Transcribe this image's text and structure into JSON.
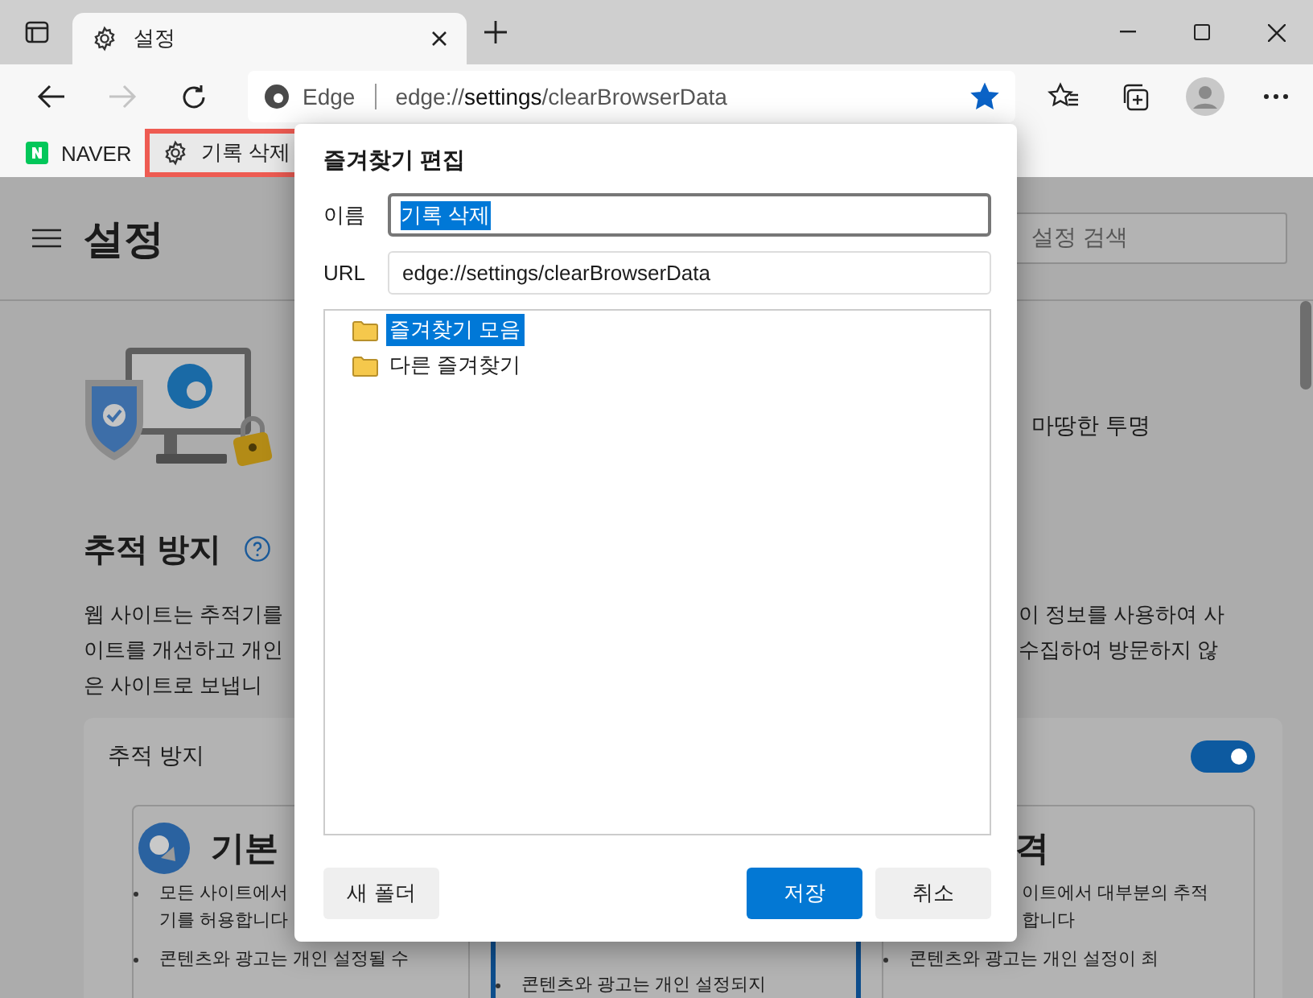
{
  "tab_bar": {
    "tabs": [
      {
        "title": "설정",
        "selected": true
      }
    ]
  },
  "toolbar": {
    "address_bar": {
      "site_label": "Edge",
      "url": "edge://**settings**/clearBrowserData",
      "favorite": true
    },
    "forward_disabled": true
  },
  "bookmarks_bar": {
    "items": [
      {
        "label": "NAVER",
        "kind": "site",
        "highlighted": false
      },
      {
        "label": "기록 삭제",
        "kind": "settings",
        "highlighted": true
      }
    ]
  },
  "settings": {
    "title": "설정",
    "search": {
      "placeholder": "설정 검색"
    },
    "banner_text": "마땅한 투명",
    "section": {
      "title": "추적 방지",
      "description_left": [
        "웹 사이트는 추적기를",
        "이트를 개선하고 개인",
        "은 사이트로 보냅니"
      ],
      "description_right": [
        "이 정보를 사용하여 사",
        "수집하여 방문하지 않"
      ]
    },
    "card": {
      "title": "추적 방지",
      "on": true,
      "options": [
        {
          "title": "기본",
          "selected": false,
          "bullets": [
            [
              "모든 사이트에서",
              "기를 허용합니다"
            ],
            [
              "콘텐츠와 광고는 개인 설정될 수"
            ]
          ]
        },
        {
          "selected": true,
          "bullets": [
            [
              "콘텐츠와 광고는 개인 설정되지"
            ]
          ]
        },
        {
          "title": "격",
          "selected": false,
          "bullets": [
            [
              "이트에서 대부분의 추적",
              "합니다"
            ],
            [
              "콘텐츠와 광고는 개인 설정이 최"
            ]
          ]
        }
      ]
    }
  },
  "dialog": {
    "title": "즐겨찾기 편집",
    "name_label": "이름",
    "name_value": "기록 삭제",
    "name_text_selected": true,
    "url_label": "URL",
    "url_value": "edge://settings/clearBrowserData",
    "folders": [
      {
        "label": "즐겨찾기 모음",
        "selected": true
      },
      {
        "label": "다른 즐겨찾기",
        "selected": false
      }
    ],
    "buttons": [
      {
        "label": "새 폴더",
        "kind": "secondary"
      },
      {
        "label": "저장",
        "kind": "primary"
      },
      {
        "label": "취소",
        "kind": "secondary"
      }
    ]
  }
}
